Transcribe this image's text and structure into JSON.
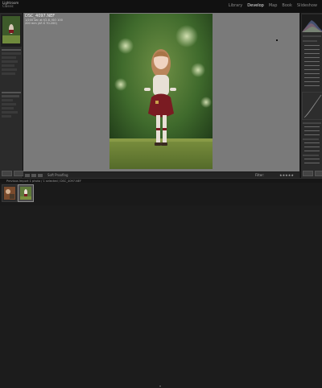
{
  "app": {
    "brand_line1": "Lightroom",
    "brand_line2": "Classic"
  },
  "modules": [
    "Library",
    "Develop",
    "Map",
    "Book",
    "Slideshow"
  ],
  "active_module": "Develop",
  "photo_info": {
    "filename": "DSC_4097.NEF",
    "line2": "1/200 sec at f/2.8, ISO 100",
    "line3": "200 mm (AF-S 70-200)"
  },
  "toolbar": {
    "softproof_label": "Soft Proofing",
    "filter_label": "Filter:",
    "stars": "★★★★★"
  },
  "filmstrip": {
    "path_text": "Previous Import  1 photo / 1 selected / DSC_4097.NEF",
    "thumbs": 2,
    "selected_index": 1
  },
  "colors": {
    "accent": "#e9e9e9",
    "panel": "#2b2b2b",
    "canvas": "#7a7a7a"
  }
}
